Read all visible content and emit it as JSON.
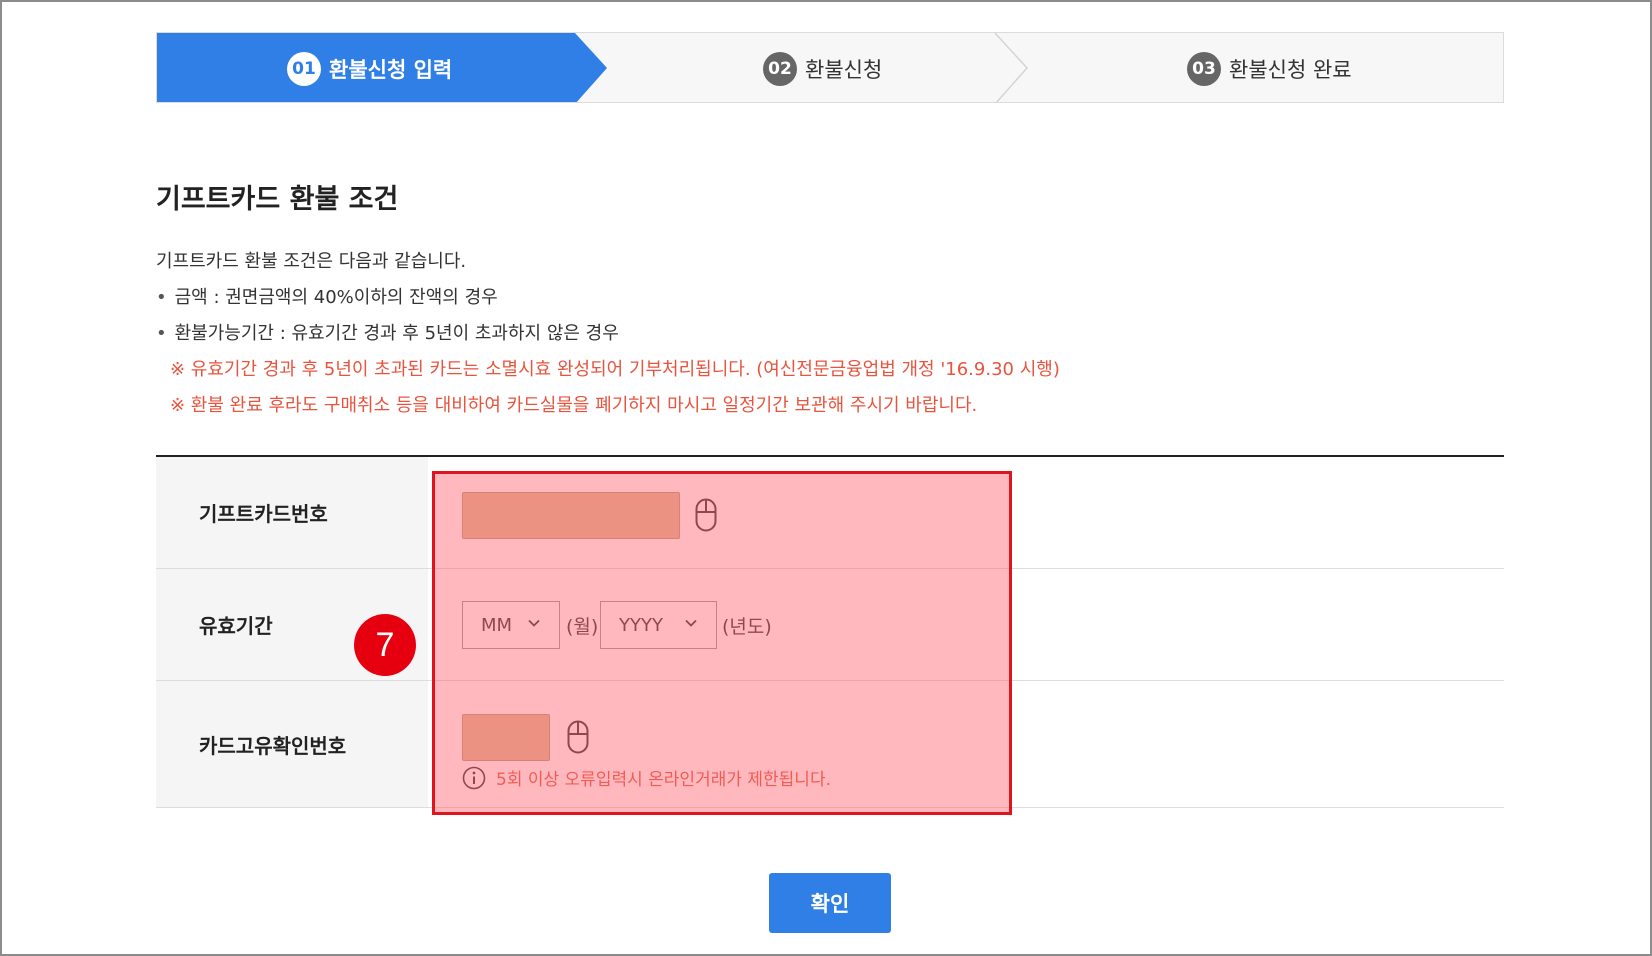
{
  "steps": [
    {
      "num": "01",
      "label": "환불신청 입력",
      "active": true
    },
    {
      "num": "02",
      "label": "환불신청",
      "active": false
    },
    {
      "num": "03",
      "label": "환불신청 완료",
      "active": false
    }
  ],
  "section_title": "기프트카드 환불 조건",
  "conditions": {
    "intro": "기프트카드 환불 조건은 다음과 같습니다.",
    "bullets": [
      "금액 : 권면금액의 40%이하의 잔액의 경우",
      "환불가능기간 : 유효기간 경과 후 5년이 초과하지 않은 경우"
    ],
    "notes": [
      "※ 유효기간 경과 후 5년이 초과된 카드는 소멸시효 완성되어 기부처리됩니다. (여신전문금융업법 개정 '16.9.30 시행)",
      "※ 환불 완료 후라도 구매취소 등을 대비하여 카드실물을 폐기하지 마시고 일정기간 보관해 주시기 바랍니다."
    ]
  },
  "form": {
    "card_number_label": "기프트카드번호",
    "card_number_value": "",
    "expiry_label": "유효기간",
    "month_select": "MM",
    "month_unit": "(월)",
    "year_select": "YYYY",
    "year_unit": "(년도)",
    "verify_label": "카드고유확인번호",
    "verify_value": "",
    "verify_warning": "5회 이상 오류입력시 온라인거래가 제한됩니다."
  },
  "annotation": {
    "marker": "7"
  },
  "confirm_label": "확인",
  "colors": {
    "accent": "#2f7fe6",
    "warning": "#e8543e",
    "highlight_border": "#e0141e",
    "input_fill": "#dbb994"
  },
  "icons": [
    "mouse-icon",
    "chevron-down-icon",
    "info-icon"
  ]
}
